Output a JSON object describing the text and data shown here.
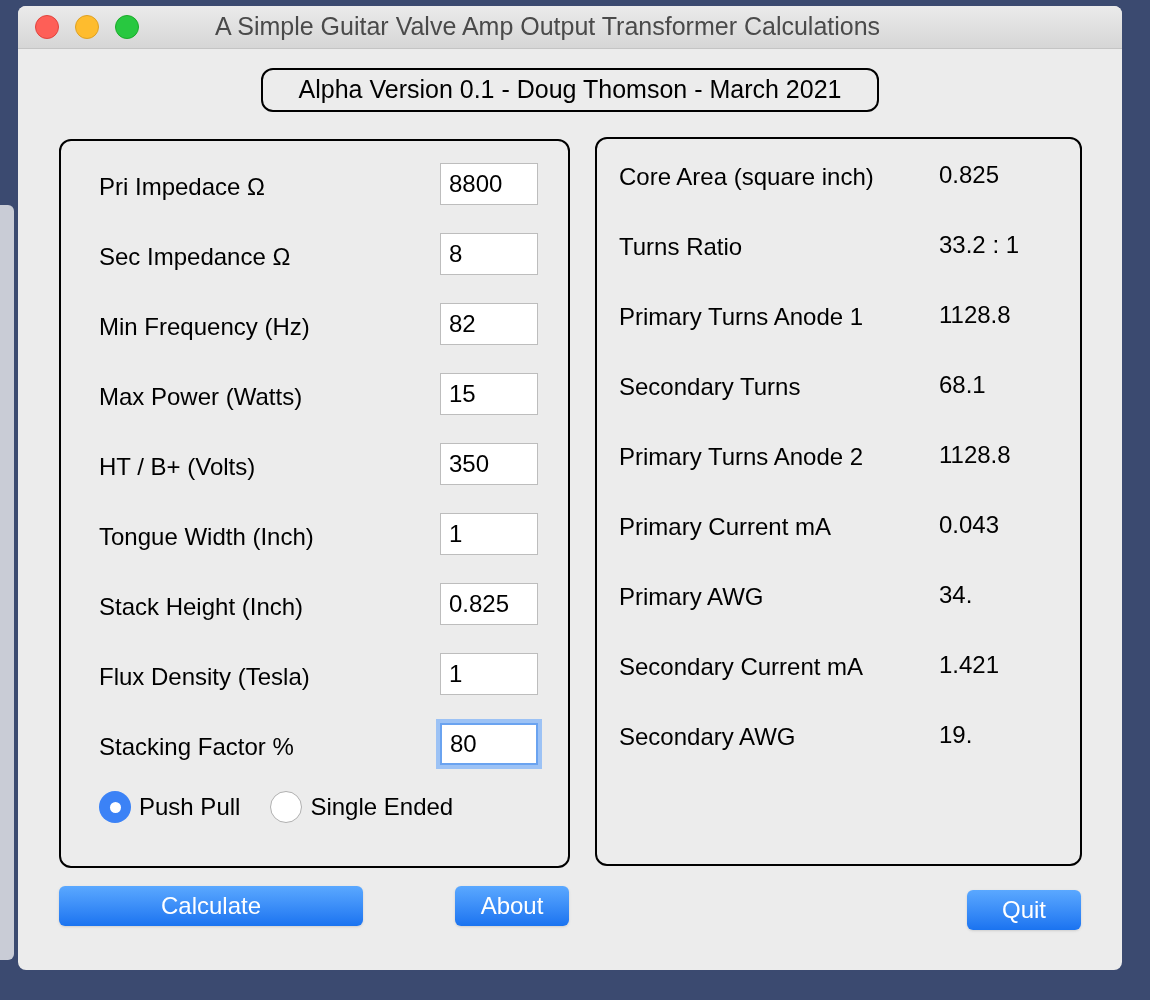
{
  "window": {
    "title": "A Simple Guitar Valve Amp Output Transformer Calculations"
  },
  "version_banner": "Alpha Version 0.1 - Doug Thomson - March 2021",
  "inputs": [
    {
      "label": "Pri Impedace Ω",
      "value": "8800",
      "focused": false
    },
    {
      "label": "Sec Impedance Ω",
      "value": "8",
      "focused": false
    },
    {
      "label": "Min Frequency (Hz)",
      "value": "82",
      "focused": false
    },
    {
      "label": "Max Power (Watts)",
      "value": "15",
      "focused": false
    },
    {
      "label": "HT / B+ (Volts)",
      "value": "350",
      "focused": false
    },
    {
      "label": "Tongue Width (Inch)",
      "value": "1",
      "focused": false
    },
    {
      "label": "Stack Height (Inch)",
      "value": "0.825",
      "focused": false
    },
    {
      "label": "Flux Density (Tesla)",
      "value": "1",
      "focused": false
    },
    {
      "label": "Stacking Factor %",
      "value": "80",
      "focused": true
    }
  ],
  "topology": [
    {
      "label": "Push Pull",
      "selected": true
    },
    {
      "label": "Single Ended",
      "selected": false
    }
  ],
  "results": [
    {
      "label": "Core Area (square inch)",
      "value": "0.825"
    },
    {
      "label": "Turns Ratio",
      "value": "33.2 : 1"
    },
    {
      "label": "Primary Turns Anode 1",
      "value": "1128.8"
    },
    {
      "label": "Secondary Turns",
      "value": "68.1"
    },
    {
      "label": "Primary Turns Anode 2",
      "value": "1128.8"
    },
    {
      "label": "Primary Current mA",
      "value": "0.043"
    },
    {
      "label": "Primary AWG",
      "value": "34."
    },
    {
      "label": "Secondary Current mA",
      "value": "1.421"
    },
    {
      "label": "Secondary AWG",
      "value": "19."
    }
  ],
  "buttons": {
    "calculate": "Calculate",
    "about": "About",
    "quit": "Quit"
  }
}
